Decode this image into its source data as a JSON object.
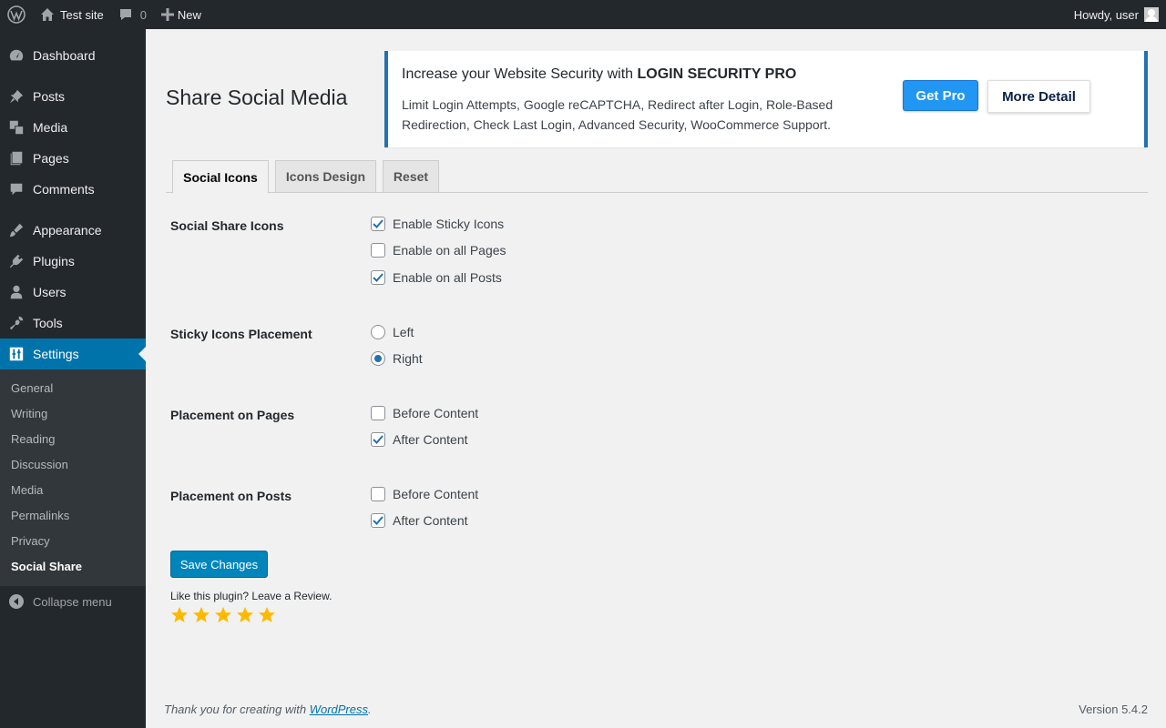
{
  "adminbar": {
    "site_name": "Test site",
    "comments_count": "0",
    "new_label": "New",
    "howdy": "Howdy, user"
  },
  "sidebar": {
    "items": [
      {
        "label": "Dashboard",
        "icon": "dashboard-icon"
      },
      {
        "label": "Posts",
        "icon": "pin-icon"
      },
      {
        "label": "Media",
        "icon": "media-icon"
      },
      {
        "label": "Pages",
        "icon": "pages-icon"
      },
      {
        "label": "Comments",
        "icon": "comment-icon"
      },
      {
        "label": "Appearance",
        "icon": "brush-icon"
      },
      {
        "label": "Plugins",
        "icon": "plug-icon"
      },
      {
        "label": "Users",
        "icon": "user-icon"
      },
      {
        "label": "Tools",
        "icon": "wrench-icon"
      },
      {
        "label": "Settings",
        "icon": "settings-icon"
      }
    ],
    "submenu": [
      "General",
      "Writing",
      "Reading",
      "Discussion",
      "Media",
      "Permalinks",
      "Privacy",
      "Social Share"
    ],
    "collapse_label": "Collapse menu"
  },
  "page": {
    "title": "Share Social Media"
  },
  "promo": {
    "title_prefix": "Increase your Website Security with ",
    "title_strong": "LOGIN SECURITY PRO",
    "description": "Limit Login Attempts, Google reCAPTCHA, Redirect after Login, Role-Based Redirection, Check Last Login, Advanced Security, WooCommerce Support.",
    "get_pro": "Get Pro",
    "more_detail": "More Detail"
  },
  "tabs": [
    "Social Icons",
    "Icons Design",
    "Reset"
  ],
  "form": {
    "social_share_icons": {
      "label": "Social Share Icons",
      "options": [
        {
          "label": "Enable Sticky Icons",
          "checked": true
        },
        {
          "label": "Enable on all Pages",
          "checked": false
        },
        {
          "label": "Enable on all Posts",
          "checked": true
        }
      ]
    },
    "sticky_placement": {
      "label": "Sticky Icons Placement",
      "options": [
        {
          "label": "Left",
          "selected": false
        },
        {
          "label": "Right",
          "selected": true
        }
      ]
    },
    "placement_pages": {
      "label": "Placement on Pages",
      "options": [
        {
          "label": "Before Content",
          "checked": false
        },
        {
          "label": "After Content",
          "checked": true
        }
      ]
    },
    "placement_posts": {
      "label": "Placement on Posts",
      "options": [
        {
          "label": "Before Content",
          "checked": false
        },
        {
          "label": "After Content",
          "checked": true
        }
      ]
    },
    "save_label": "Save Changes"
  },
  "review": {
    "text": "Like this plugin? Leave a Review.",
    "stars": 5
  },
  "footer": {
    "thanks_prefix": "Thank you for creating with ",
    "link_text": "WordPress",
    "thanks_suffix": ".",
    "version": "Version 5.4.2"
  },
  "colors": {
    "admin_dark": "#23282d",
    "accent_blue": "#0073aa",
    "checkbox_blue": "#2271b1",
    "star_gold": "#ffb900"
  }
}
